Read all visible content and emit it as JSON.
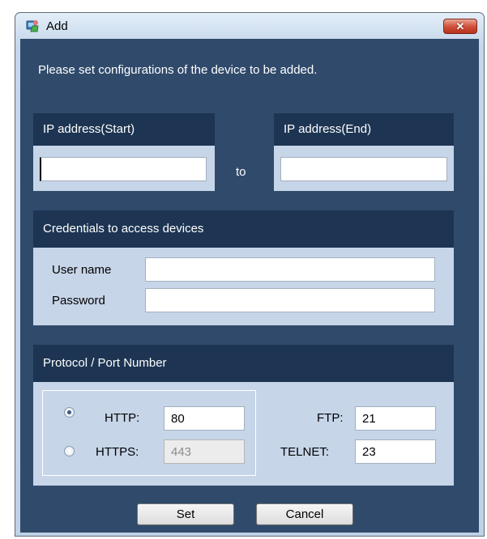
{
  "window": {
    "title": "Add",
    "close_symbol": "✕",
    "icon": "app-icon"
  },
  "instructions": "Please set configurations of the device to be added.",
  "ip": {
    "start_label": "IP address(Start)",
    "end_label": "IP address(End)",
    "to_label": "to",
    "start_value": "",
    "end_value": ""
  },
  "credentials": {
    "header": "Credentials to access devices",
    "username_label": "User name",
    "password_label": "Password",
    "username_value": "",
    "password_value": ""
  },
  "protocol": {
    "header": "Protocol / Port Number",
    "http_label": "HTTP:",
    "http_port": "80",
    "http_selected": true,
    "https_label": "HTTPS:",
    "https_port": "443",
    "https_selected": false,
    "ftp_label": "FTP:",
    "ftp_port": "21",
    "telnet_label": "TELNET:",
    "telnet_port": "23"
  },
  "buttons": {
    "set": "Set",
    "cancel": "Cancel"
  },
  "colors": {
    "client_bg": "#304a6b",
    "panel_header": "#1d3552",
    "panel_body": "#c6d5e8",
    "close_red": "#c9452f"
  }
}
